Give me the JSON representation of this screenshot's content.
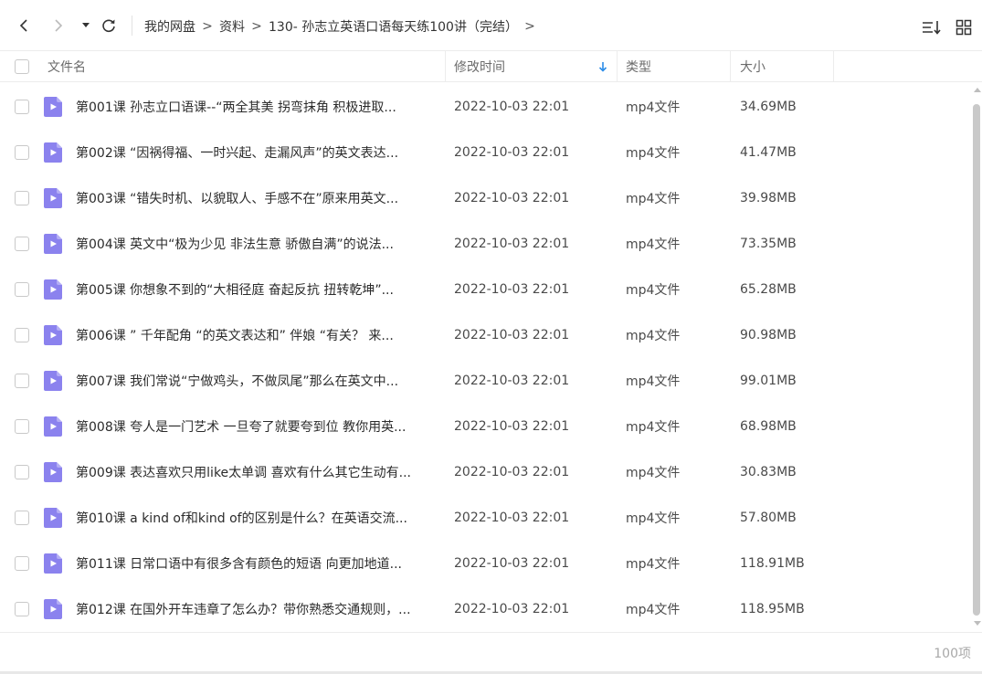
{
  "toolbar": {
    "breadcrumb": [
      "我的网盘",
      "资料",
      "130- 孙志立英语口语每天练100讲（完结）"
    ],
    "breadcrumb_sep": ">"
  },
  "header": {
    "name": "文件名",
    "time": "修改时间",
    "type": "类型",
    "size": "大小"
  },
  "colors": {
    "accent": "#2b8ce8",
    "file_icon": "#8b82ee"
  },
  "files": [
    {
      "name": "第001课 孙志立口语课--“两全其美 拐弯抹角 积极进取...",
      "time": "2022-10-03 22:01",
      "type": "mp4文件",
      "size": "34.69MB"
    },
    {
      "name": "第002课 “因祸得福、一时兴起、走漏风声”的英文表达...",
      "time": "2022-10-03 22:01",
      "type": "mp4文件",
      "size": "41.47MB"
    },
    {
      "name": "第003课 “错失时机、以貌取人、手感不在”原来用英文...",
      "time": "2022-10-03 22:01",
      "type": "mp4文件",
      "size": "39.98MB"
    },
    {
      "name": "第004课 英文中“极为少见 非法生意 骄傲自满”的说法...",
      "time": "2022-10-03 22:01",
      "type": "mp4文件",
      "size": "73.35MB"
    },
    {
      "name": "第005课 你想象不到的“大相径庭 奋起反抗 扭转乾坤”...",
      "time": "2022-10-03 22:01",
      "type": "mp4文件",
      "size": "65.28MB"
    },
    {
      "name": "第006课 ” 千年配角 “的英文表达和” 伴娘 “有关？ 来...",
      "time": "2022-10-03 22:01",
      "type": "mp4文件",
      "size": "90.98MB"
    },
    {
      "name": "第007课 我们常说“宁做鸡头，不做凤尾”那么在英文中...",
      "time": "2022-10-03 22:01",
      "type": "mp4文件",
      "size": "99.01MB"
    },
    {
      "name": "第008课 夸人是一门艺术 一旦夸了就要夸到位 教你用英...",
      "time": "2022-10-03 22:01",
      "type": "mp4文件",
      "size": "68.98MB"
    },
    {
      "name": "第009课 表达喜欢只用like太单调 喜欢有什么其它生动有...",
      "time": "2022-10-03 22:01",
      "type": "mp4文件",
      "size": "30.83MB"
    },
    {
      "name": "第010课 a kind of和kind of的区别是什么？在英语交流...",
      "time": "2022-10-03 22:01",
      "type": "mp4文件",
      "size": "57.80MB"
    },
    {
      "name": "第011课 日常口语中有很多含有颜色的短语 向更加地道...",
      "time": "2022-10-03 22:01",
      "type": "mp4文件",
      "size": "118.91MB"
    },
    {
      "name": "第012课 在国外开车违章了怎么办？带你熟悉交通规则，...",
      "time": "2022-10-03 22:01",
      "type": "mp4文件",
      "size": "118.95MB"
    }
  ],
  "footer": {
    "count": "100项"
  }
}
